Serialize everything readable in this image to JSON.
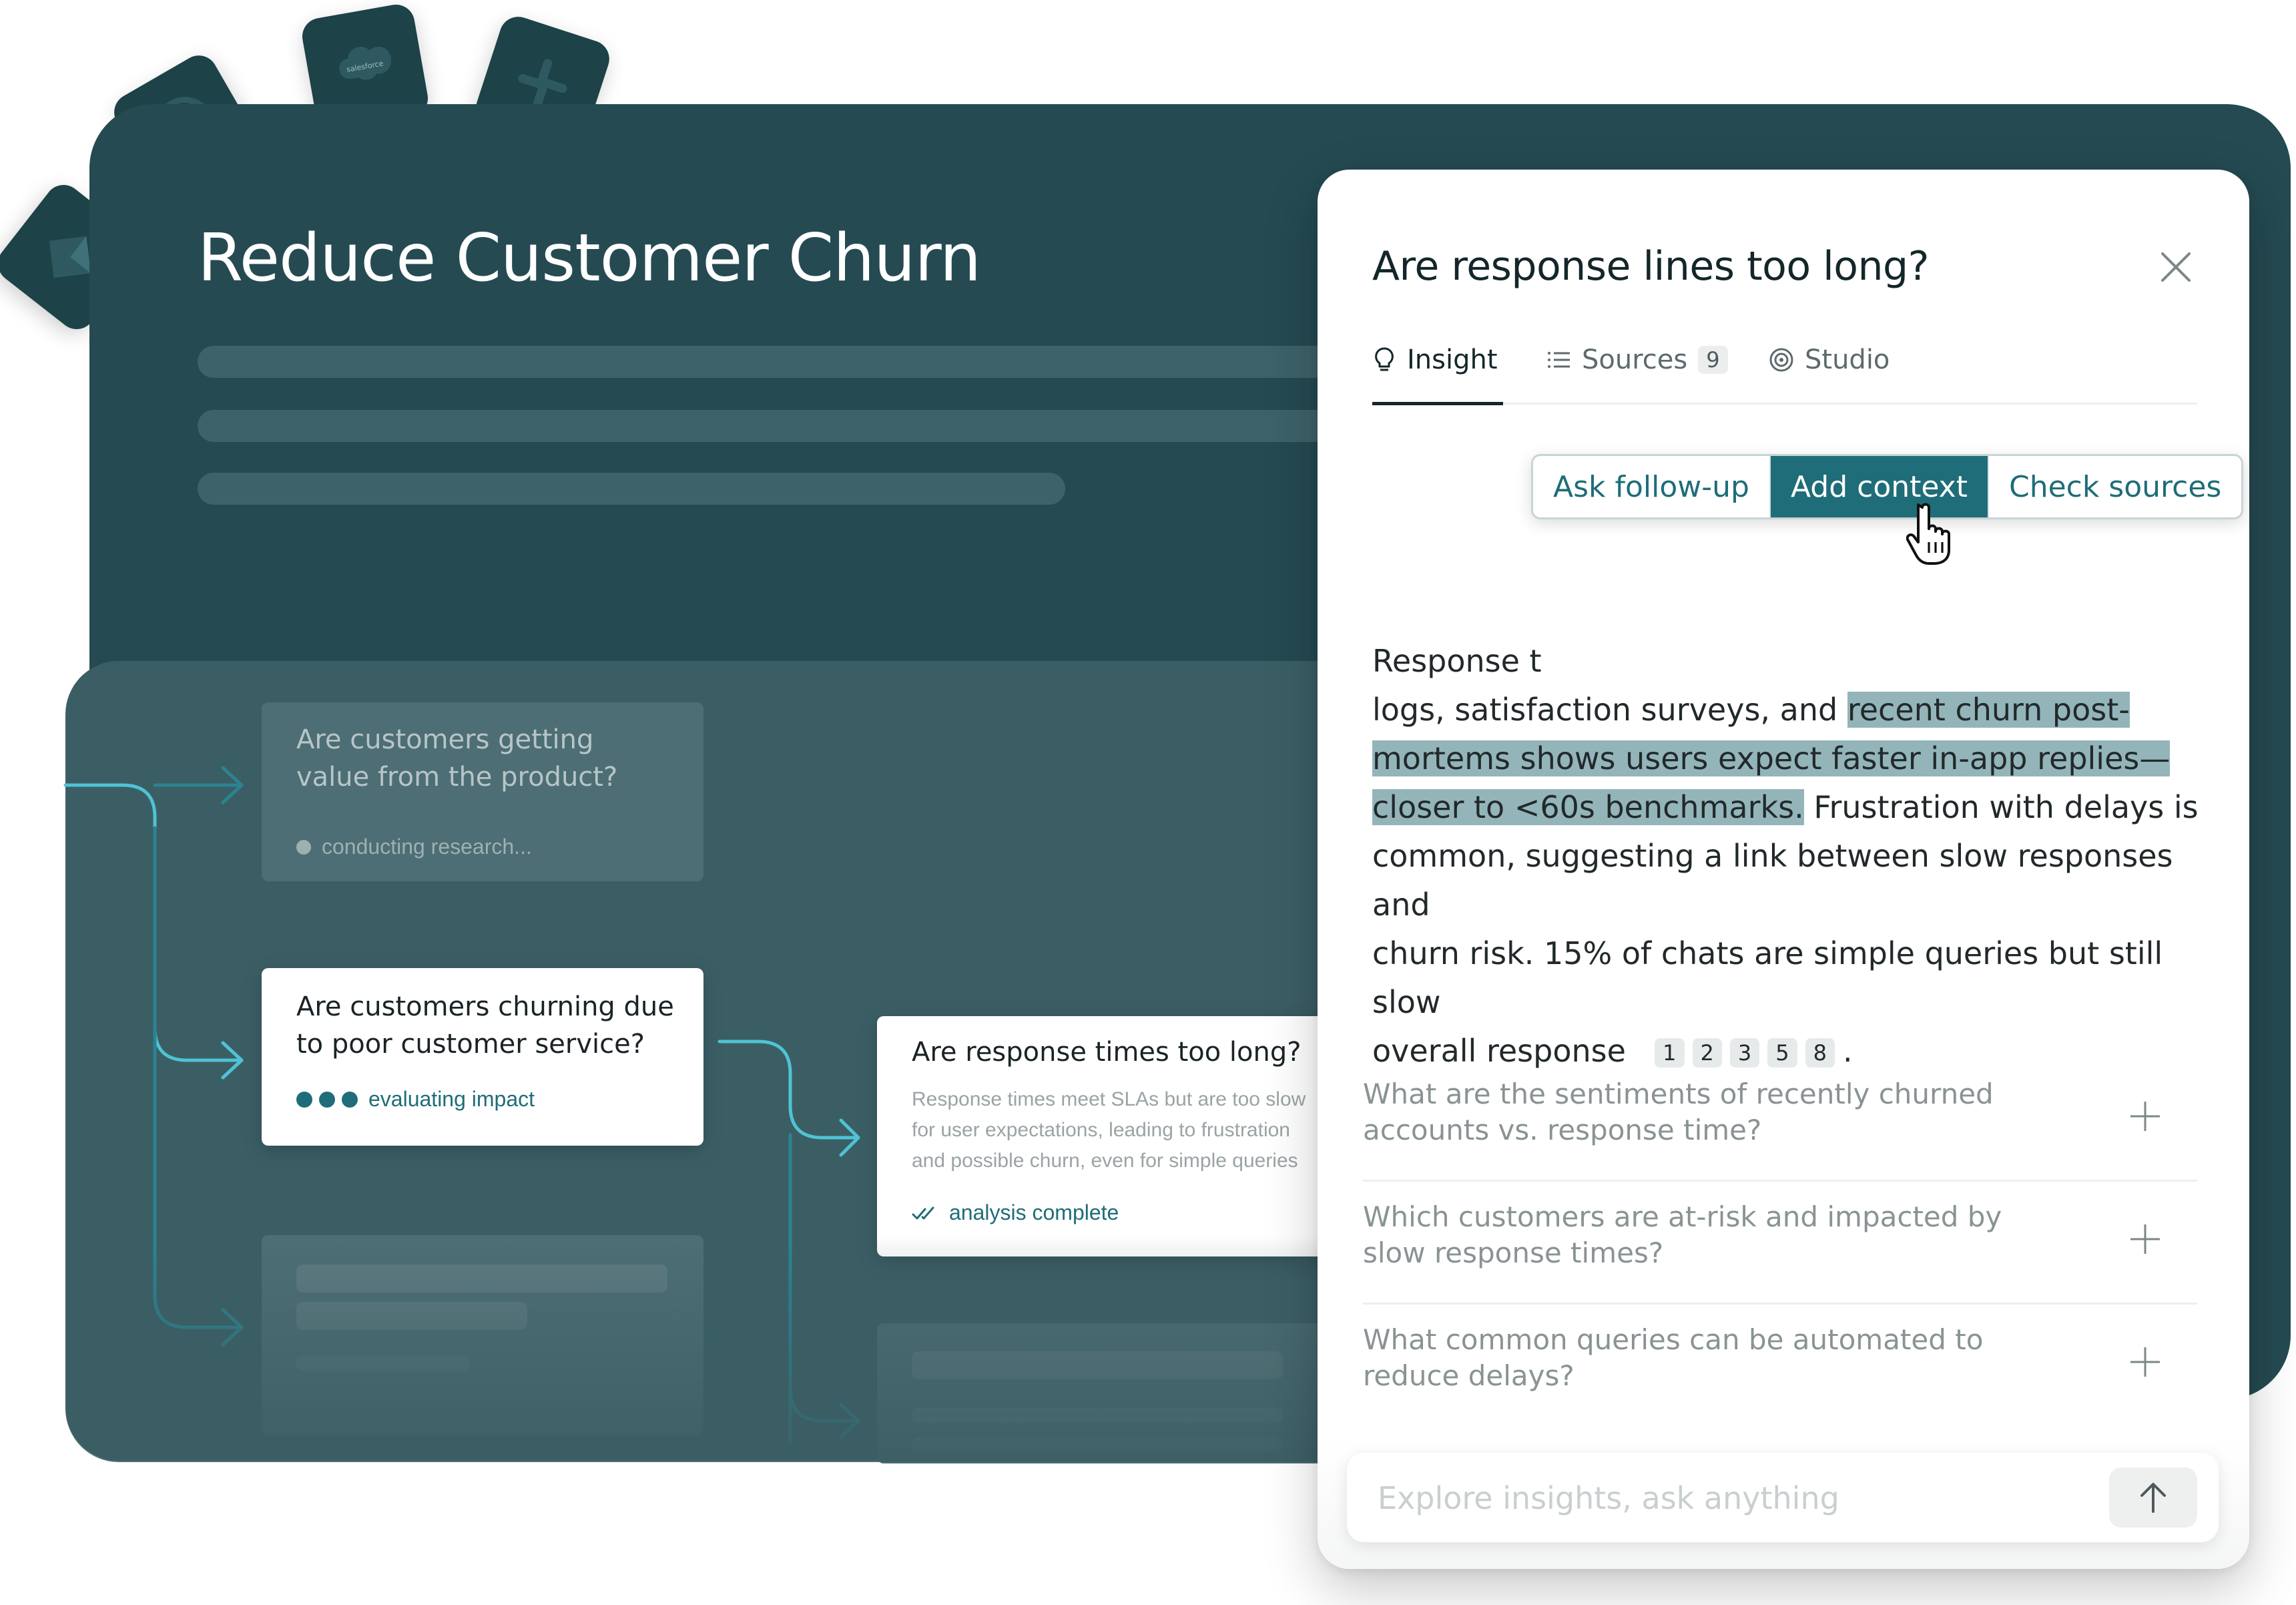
{
  "integrations": [
    {
      "name": "dark-app-icon"
    },
    {
      "name": "github-icon"
    },
    {
      "name": "salesforce-icon",
      "label": "salesforce"
    },
    {
      "name": "slack-icon"
    }
  ],
  "board": {
    "title": "Reduce Customer Churn"
  },
  "nodes": {
    "value": {
      "title": "Are customers getting value from the product?",
      "status": "conducting research..."
    },
    "churn": {
      "title": "Are customers churning due to poor customer service?",
      "status": "evaluating impact"
    },
    "response": {
      "title": "Are response times too long?",
      "desc_lines": [
        "Response times meet SLAs but are too slow",
        "for user expectations, leading to frustration",
        "and possible churn, even for simple queries"
      ],
      "status": "analysis complete"
    }
  },
  "panel": {
    "title": "Are response lines too long?",
    "tabs": {
      "insight": "Insight",
      "sources": "Sources",
      "sources_count": "9",
      "studio": "Studio"
    },
    "actions": {
      "ask": "Ask follow-up",
      "add": "Add context",
      "check": "Check sources"
    },
    "insight": {
      "t1": "Response t",
      "t2": "logs, satisfaction surveys, and ",
      "h1": "recent churn post-",
      "h2": "mortems shows users expect faster in-app replies—",
      "h3": "closer to <60s benchmarks.",
      "t3": " Frustration with delays is",
      "t4": "common, suggesting a link between slow responses and",
      "t5": "churn risk. 15% of chats are simple queries but still slow",
      "t6": "overall response",
      "citations": [
        "1",
        "2",
        "3",
        "5",
        "8"
      ],
      "end": "."
    },
    "questions": [
      "What are the sentiments of recently churned accounts vs. response time?",
      "Which customers are at-risk and impacted by slow response times?",
      "What common queries can be automated to reduce delays?"
    ],
    "input_placeholder": "Explore insights, ask anything"
  },
  "colors": {
    "board": "#254a52",
    "canvas": "#3b5e65",
    "accent": "#1f6d78",
    "highlight": "#93b5ba",
    "connector": "#4fc3d4"
  }
}
